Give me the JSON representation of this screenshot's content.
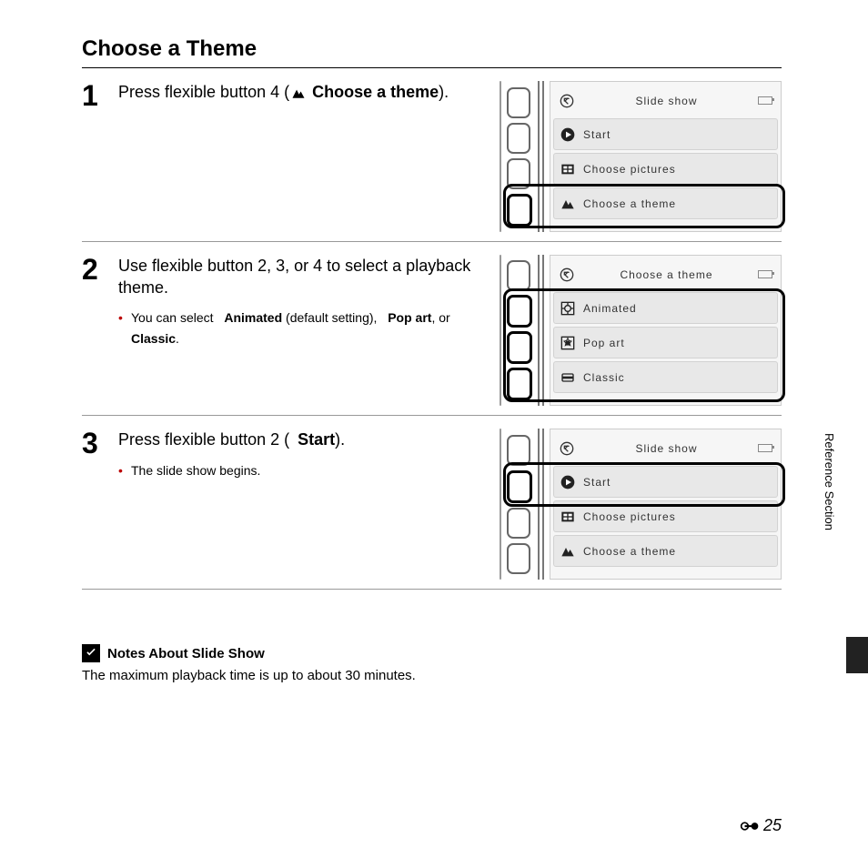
{
  "title": "Choose a Theme",
  "sideTab": "Reference Section",
  "pageNumber": "25",
  "steps": [
    {
      "num": "1",
      "main_before": "Press flexible button 4 (",
      "main_bold": "Choose a theme",
      "main_after": ").",
      "sub": [],
      "fig": {
        "title": "Slide show",
        "items": [
          {
            "icon": "back",
            "label": "Slide show",
            "isTitle": true
          },
          {
            "icon": "play",
            "label": "Start"
          },
          {
            "icon": "pictures",
            "label": "Choose pictures"
          },
          {
            "icon": "theme",
            "label": "Choose a theme"
          }
        ],
        "highlightRow": 3,
        "highlightBtn": 3
      }
    },
    {
      "num": "2",
      "main_before": "Use flexible button 2, 3, or 4 to select a playback theme.",
      "main_bold": "",
      "main_after": "",
      "sub_html": true,
      "sub": [
        "You can select  <b>Animated</b> (default setting),  <b>Pop art</b>, or  <b>Classic</b>."
      ],
      "fig": {
        "items": [
          {
            "icon": "back",
            "label": "Choose a theme",
            "isTitle": true
          },
          {
            "icon": "animated",
            "label": "Animated"
          },
          {
            "icon": "popart",
            "label": "Pop art"
          },
          {
            "icon": "classic",
            "label": "Classic"
          }
        ],
        "highlightRows": [
          1,
          2,
          3
        ],
        "highlightBtns": [
          1,
          2,
          3
        ]
      }
    },
    {
      "num": "3",
      "main_before": "Press flexible button 2 (",
      "main_bold": "Start",
      "main_after": ").",
      "play_icon": true,
      "sub": [
        "The slide show begins."
      ],
      "fig": {
        "items": [
          {
            "icon": "back",
            "label": "Slide show",
            "isTitle": true
          },
          {
            "icon": "play",
            "label": "Start"
          },
          {
            "icon": "pictures",
            "label": "Choose pictures"
          },
          {
            "icon": "theme",
            "label": "Choose a theme"
          }
        ],
        "highlightRow": 1,
        "highlightBtn": 1
      }
    }
  ],
  "notes": {
    "heading": "Notes About Slide Show",
    "text": "The maximum playback time is up to about 30 minutes."
  }
}
